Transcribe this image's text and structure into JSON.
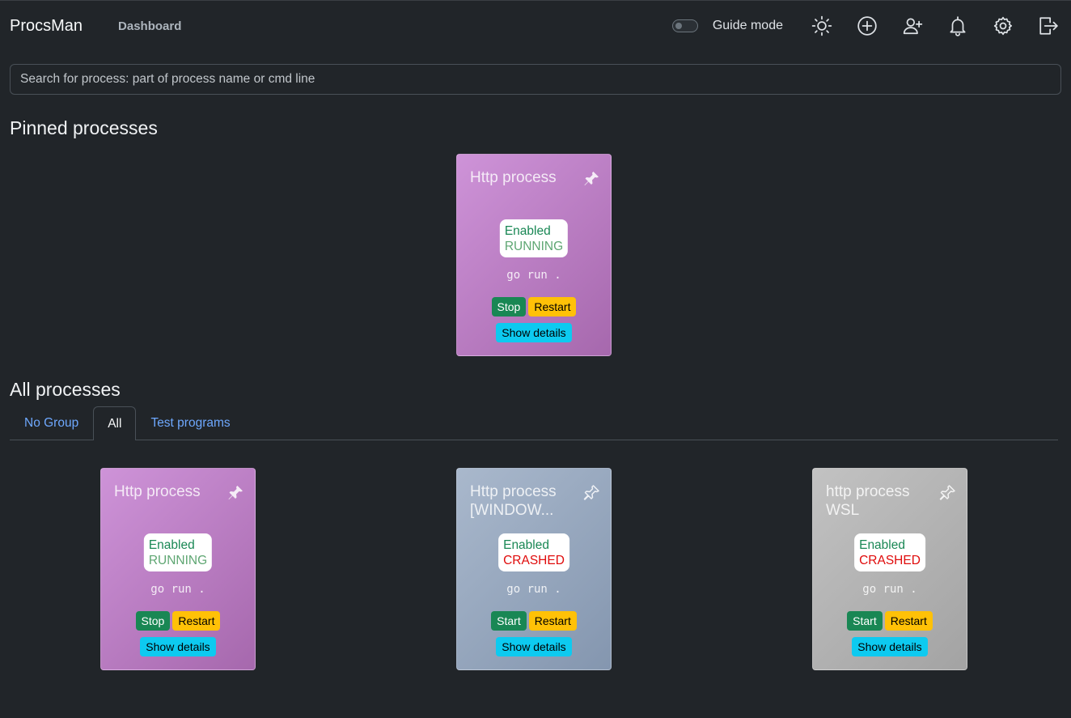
{
  "navbar": {
    "brand": "ProcsMan",
    "link": "Dashboard",
    "guide_label": "Guide mode",
    "icons": [
      "sun-icon",
      "add-circle-icon",
      "add-user-icon",
      "bell-icon",
      "gear-icon",
      "logout-icon"
    ]
  },
  "search": {
    "placeholder": "Search for process: part of process name or cmd line",
    "value": ""
  },
  "pinned": {
    "title": "Pinned processes",
    "cards": [
      {
        "name": "Http process",
        "enabled": "Enabled",
        "state": "RUNNING",
        "cmd": "go run .",
        "primary": "Stop",
        "restart": "Restart",
        "details": "Show details",
        "pinned": true
      }
    ]
  },
  "all": {
    "title": "All processes",
    "tabs": [
      "No Group",
      "All",
      "Test programs"
    ],
    "active_tab": "All",
    "cards": [
      {
        "name": "Http process",
        "enabled": "Enabled",
        "state": "RUNNING",
        "cmd": "go run .",
        "primary": "Stop",
        "restart": "Restart",
        "details": "Show details",
        "pinned": true
      },
      {
        "name": "Http process [WINDOW...",
        "enabled": "Enabled",
        "state": "CRASHED",
        "cmd": "go run .",
        "primary": "Start",
        "restart": "Restart",
        "details": "Show details",
        "pinned": false
      },
      {
        "name": "http process WSL",
        "enabled": "Enabled",
        "state": "CRASHED",
        "cmd": "go run .",
        "primary": "Start",
        "restart": "Restart",
        "details": "Show details",
        "pinned": false
      }
    ]
  },
  "colors": {
    "background": "#212529",
    "link": "#6ea8fe",
    "success": "#198754",
    "warning": "#ffc107",
    "info": "#0dcaf0",
    "danger": "#e00b0b",
    "card_purple": "#b87cc0",
    "card_blue": "#96a7be",
    "card_gray": "#b3b3b3"
  }
}
